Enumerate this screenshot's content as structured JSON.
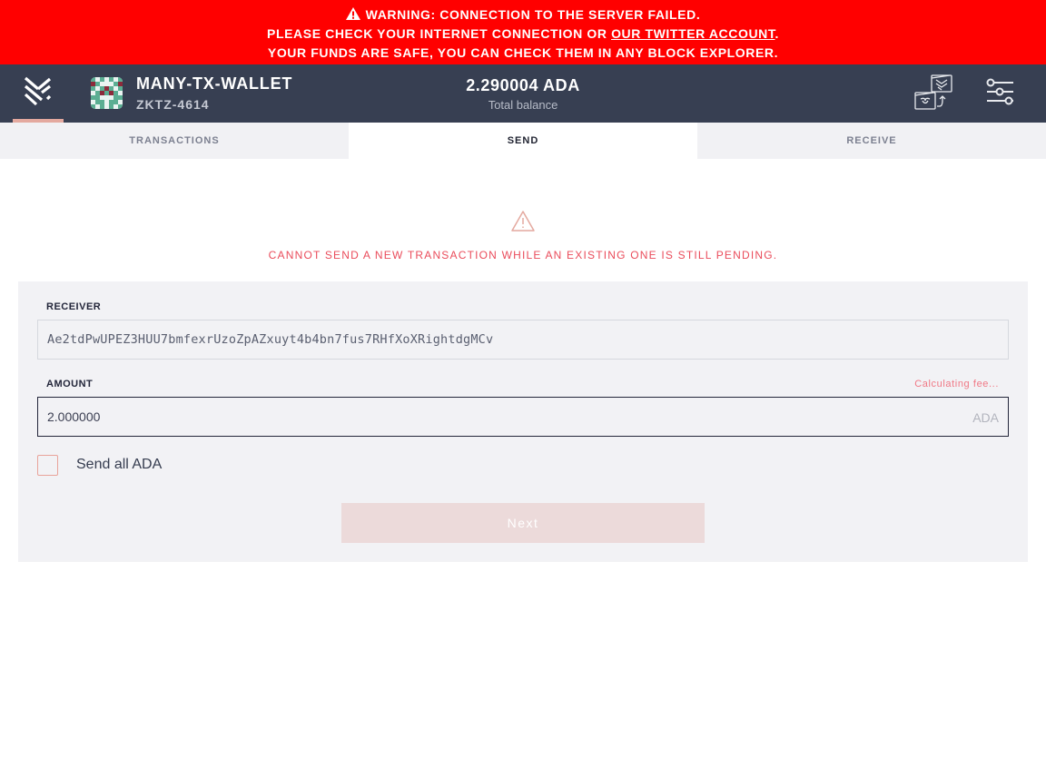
{
  "banner": {
    "icon": "warning-triangle-icon",
    "line1": "WARNING: CONNECTION TO THE SERVER FAILED.",
    "line2_prefix": "PLEASE CHECK YOUR INTERNET CONNECTION OR ",
    "line2_link": "OUR TWITTER ACCOUNT",
    "line2_suffix": ".",
    "line3": "YOUR FUNDS ARE SAFE, YOU CAN CHECK THEM IN ANY BLOCK EXPLORER.",
    "background_color": "#ff0000"
  },
  "topbar": {
    "logo_icon": "daedalus-logo-icon",
    "wallet": {
      "name": "MANY-TX-WALLET",
      "id": "ZKTZ-4614",
      "avatar_icon": "wallet-identicon"
    },
    "balance": {
      "amount": "2.290004 ADA",
      "label": "Total balance"
    },
    "actions": [
      {
        "name": "transfer-funds",
        "icon": "wallet-transfer-icon"
      },
      {
        "name": "settings",
        "icon": "sliders-icon"
      }
    ],
    "background_color": "#373f52"
  },
  "tabs": [
    {
      "label": "TRANSACTIONS",
      "active": false
    },
    {
      "label": "SEND",
      "active": true
    },
    {
      "label": "RECEIVE",
      "active": false
    }
  ],
  "notice": {
    "icon": "warning-triangle-icon",
    "text": "CANNOT SEND A NEW TRANSACTION WHILE AN EXISTING ONE IS STILL PENDING.",
    "color": "#ea4c5b"
  },
  "form": {
    "receiver": {
      "label": "RECEIVER",
      "value": "Ae2tdPwUPEZ3HUU7bmfexrUzoZpAZxuyt4b4bn7fus7RHfXoXRightdgMCv"
    },
    "amount": {
      "label": "AMOUNT",
      "value": "2.000000",
      "currency": "ADA",
      "fee_status": "Calculating fee..."
    },
    "send_all": {
      "label": "Send all ADA",
      "checked": false
    },
    "next_button": {
      "label": "Next",
      "disabled": true
    }
  }
}
